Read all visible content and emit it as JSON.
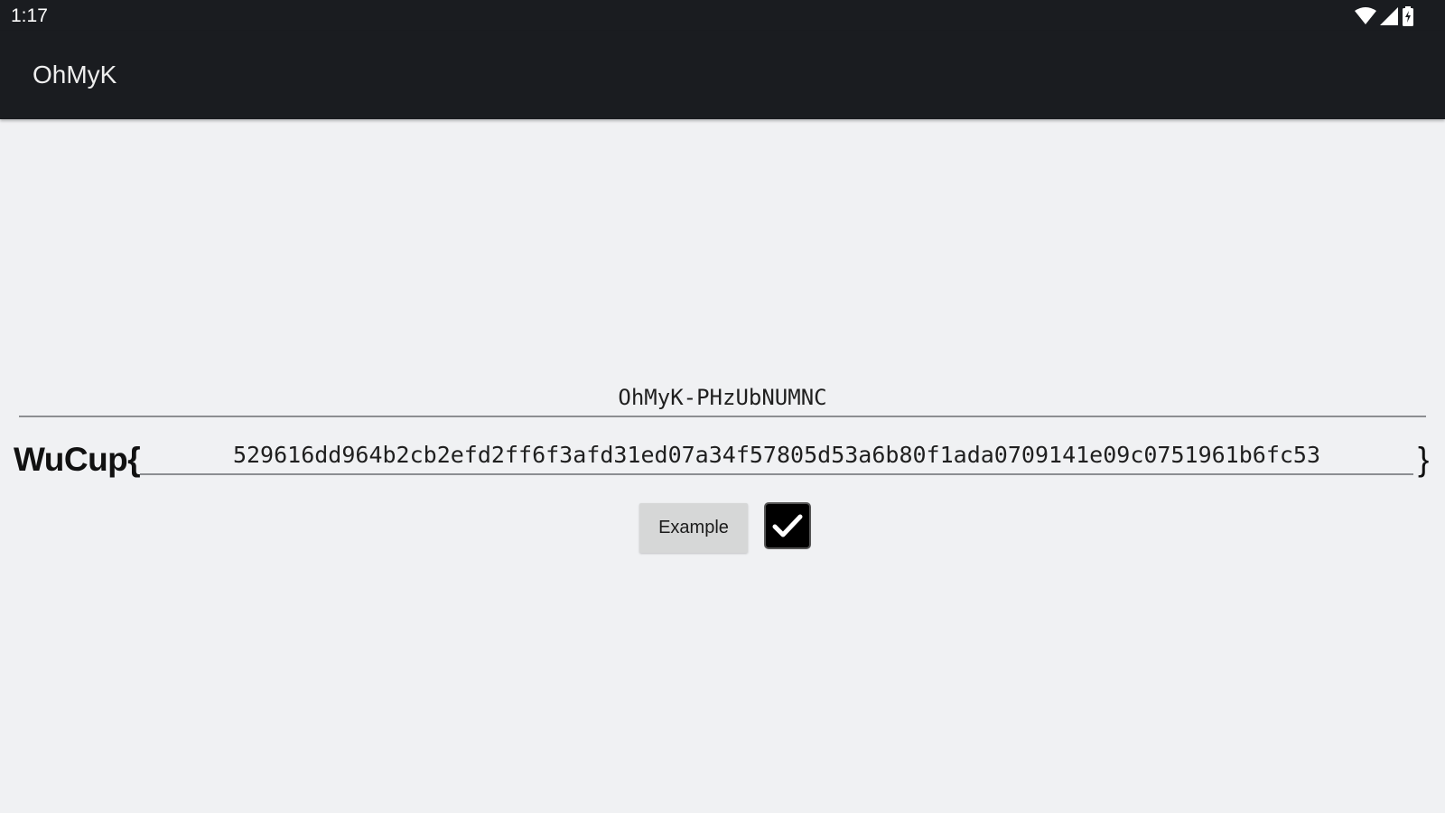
{
  "status_bar": {
    "time": "1:17",
    "icons": [
      "wifi-icon",
      "cell-signal-icon",
      "battery-charging-icon"
    ]
  },
  "app_bar": {
    "title": "OhMyK"
  },
  "main": {
    "name_field_value": "OhMyK-PHzUbNUMNC",
    "flag_prefix": "WuCup{",
    "flag_field_value": "529616dd964b2cb2efd2ff6f3afd31ed07a34f57805d53a6b80f1ada0709141e09c0751961b6fc53",
    "flag_suffix": "}",
    "example_button_label": "Example",
    "checkbox_checked": true
  },
  "colors": {
    "app_bar_background": "#1a1c20",
    "page_background": "#f0f1f3",
    "button_background": "#d6d7d7"
  }
}
